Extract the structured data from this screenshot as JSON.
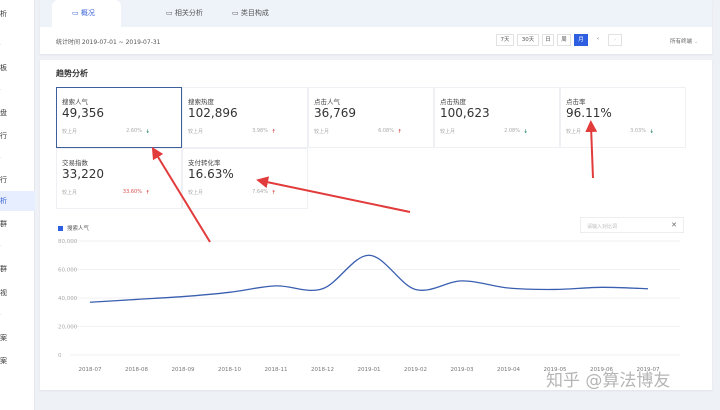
{
  "sidebar": {
    "items": [
      {
        "label": "析",
        "muted": false
      },
      {
        "label": "·",
        "muted": true
      },
      {
        "label": "板",
        "muted": false
      },
      {
        "label": "·",
        "muted": true
      },
      {
        "label": "盘",
        "muted": false
      },
      {
        "label": "行",
        "muted": false
      },
      {
        "label": "·",
        "muted": true
      },
      {
        "label": "行",
        "muted": false
      },
      {
        "label": "析",
        "muted": false,
        "active": true
      },
      {
        "label": "群",
        "muted": false
      },
      {
        "label": "·",
        "muted": true
      },
      {
        "label": "群",
        "muted": false
      },
      {
        "label": "视",
        "muted": false
      },
      {
        "label": "·",
        "muted": true
      },
      {
        "label": "案",
        "muted": false
      },
      {
        "label": "案",
        "muted": false
      }
    ]
  },
  "tabs": [
    "概况",
    "相关分析",
    "类目构成"
  ],
  "date_label": "统计时间 2019-07-01 ~ 2019-07-31",
  "period_buttons": [
    "7天",
    "30天",
    "日",
    "周",
    "月"
  ],
  "active_period": "月",
  "prev": "‹",
  "next": "›",
  "terminal_select": "所有终端",
  "trend": {
    "title": "趋势分析",
    "compare_label": "较上月",
    "metrics": [
      {
        "label": "搜索人气",
        "value": "49,356",
        "pct": "2.60%",
        "dir": "down"
      },
      {
        "label": "搜索热度",
        "value": "102,896",
        "pct": "3.98%",
        "dir": "up"
      },
      {
        "label": "点击人气",
        "value": "36,769",
        "pct": "6.08%",
        "dir": "up"
      },
      {
        "label": "点击热度",
        "value": "100,623",
        "pct": "2.08%",
        "dir": "down"
      },
      {
        "label": "点击率",
        "value": "96.11%",
        "pct": "3.03%",
        "dir": "down"
      },
      {
        "label": "交易指数",
        "value": "33,220",
        "pct": "33.60%",
        "dir": "up"
      },
      {
        "label": "支付转化率",
        "value": "16.63%",
        "pct": "7.64%",
        "dir": "up"
      }
    ]
  },
  "search_placeholder": "请输入对比词",
  "chart_data": {
    "type": "line",
    "title": "",
    "legend": [
      "搜索人气"
    ],
    "legend_position": "top-left",
    "x": [
      "2018-07",
      "2018-08",
      "2018-09",
      "2018-10",
      "2018-11",
      "2018-12",
      "2019-01",
      "2019-02",
      "2019-03",
      "2019-04",
      "2019-05",
      "2019-06",
      "2019-07"
    ],
    "series": [
      {
        "name": "搜索人气",
        "values": [
          37000,
          39000,
          41000,
          44000,
          48500,
          46500,
          70000,
          46000,
          52000,
          47000,
          46000,
          47500,
          46500
        ]
      }
    ],
    "yticks": [
      "0",
      "20,000",
      "40,000",
      "60,000",
      "80,000"
    ],
    "ylim": [
      0,
      80000
    ],
    "color": "#3a5fb0"
  },
  "watermark": "知乎 @算法博友",
  "colors": {
    "accent": "#2e5fe0",
    "up": "#d9534f",
    "down": "#2f8f6a",
    "annotation": "#e23b3b"
  }
}
